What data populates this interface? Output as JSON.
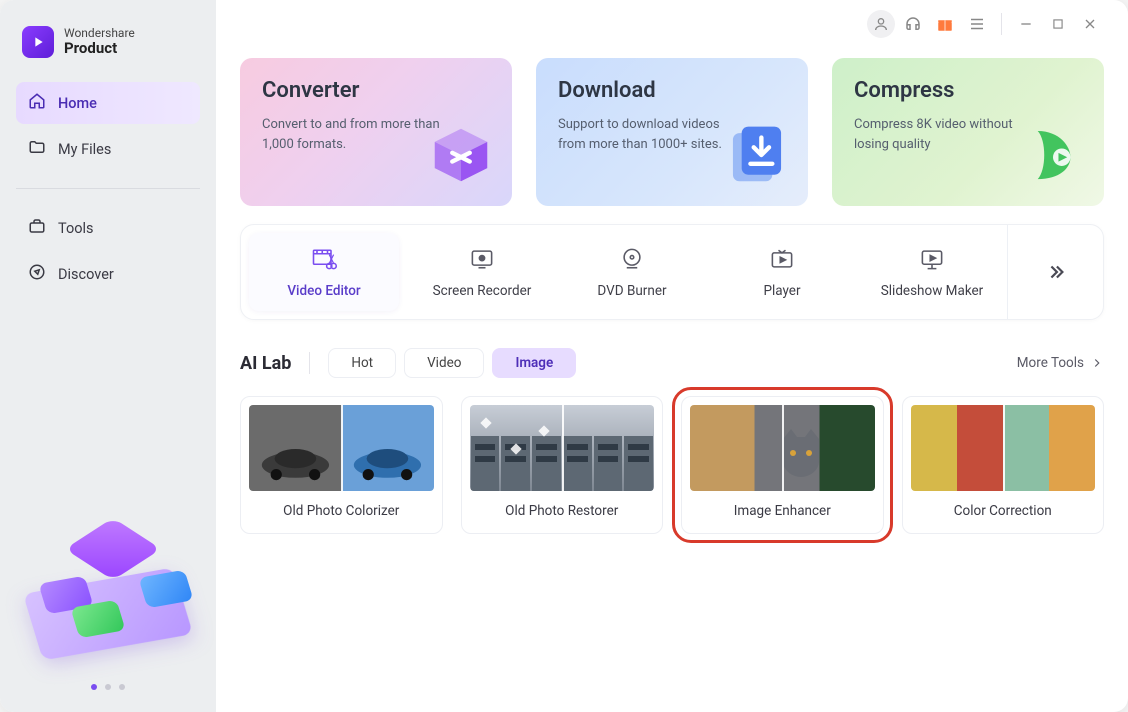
{
  "brand": {
    "line1": "Wondershare",
    "line2": "Product"
  },
  "sidebar": {
    "items": [
      {
        "label": "Home"
      },
      {
        "label": "My Files"
      },
      {
        "label": "Tools"
      },
      {
        "label": "Discover"
      }
    ]
  },
  "promos": {
    "converter": {
      "title": "Converter",
      "desc": "Convert to and from more than 1,000 formats."
    },
    "download": {
      "title": "Download",
      "desc": "Support to download videos from more than 1000+ sites."
    },
    "compress": {
      "title": "Compress",
      "desc": "Compress 8K video without losing quality"
    }
  },
  "tools": [
    {
      "label": "Video Editor"
    },
    {
      "label": "Screen Recorder"
    },
    {
      "label": "DVD Burner"
    },
    {
      "label": "Player"
    },
    {
      "label": "Slideshow Maker"
    }
  ],
  "ailab": {
    "title": "AI Lab",
    "tabs": [
      {
        "label": "Hot"
      },
      {
        "label": "Video"
      },
      {
        "label": "Image"
      }
    ],
    "more": "More Tools",
    "cards": [
      {
        "label": "Old Photo Colorizer"
      },
      {
        "label": "Old Photo Restorer"
      },
      {
        "label": "Image Enhancer"
      },
      {
        "label": "Color Correction"
      }
    ]
  }
}
